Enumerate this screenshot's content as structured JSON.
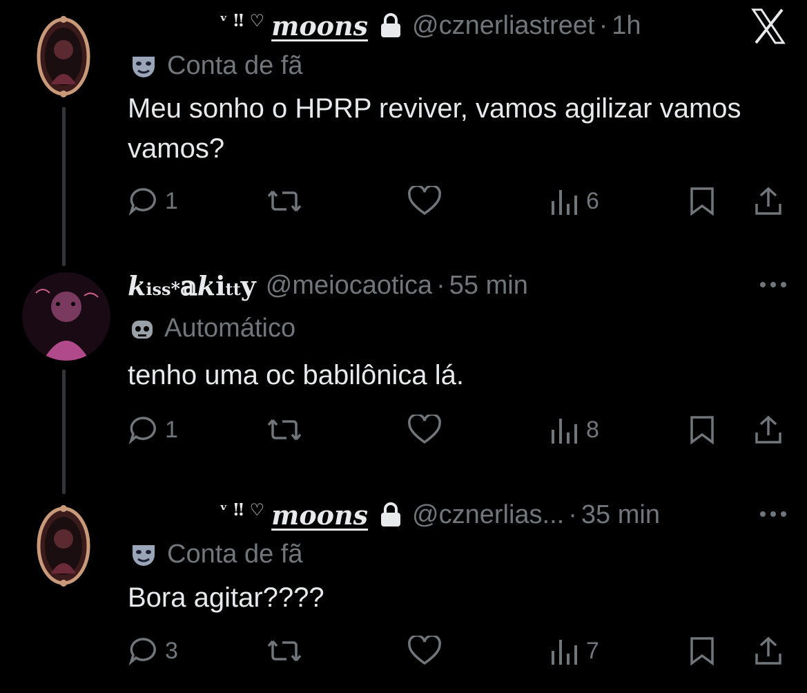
{
  "close_button": {
    "label": "X"
  },
  "tweets": [
    {
      "display_name_deco": "ᵛ ‼ ♡",
      "display_name": "moons",
      "handle": "@cznerliastreet",
      "time": "1h",
      "label": "Conta de fã",
      "text": "Meu sonho o HPRP reviver, vamos agilizar vamos vamos?",
      "replies": "1",
      "views": "6"
    },
    {
      "display_name_parts": [
        "𝒌",
        "iss",
        "*",
        "𝕒",
        "𝒌",
        "i",
        "tt",
        "y"
      ],
      "handle": "@meiocaotica",
      "time": "55 min",
      "label": "Automático",
      "text": "tenho uma oc babilônica lá.",
      "replies": "1",
      "views": "8"
    },
    {
      "display_name_deco": "ᵛ ‼ ♡",
      "display_name": "moons",
      "handle": "@cznerlias...",
      "time": "35 min",
      "label": "Conta de fã",
      "text": "Bora agitar????",
      "replies": "3",
      "views": "7"
    }
  ],
  "colors": {
    "background": "#000000",
    "text": "#e7e9ea",
    "muted": "#71767b",
    "thread_line": "#333639"
  },
  "icons": [
    "lock-icon",
    "masks-icon",
    "robot-icon",
    "reply-icon",
    "retweet-icon",
    "like-icon",
    "views-icon",
    "bookmark-icon",
    "share-icon",
    "more-icon",
    "close-icon"
  ]
}
